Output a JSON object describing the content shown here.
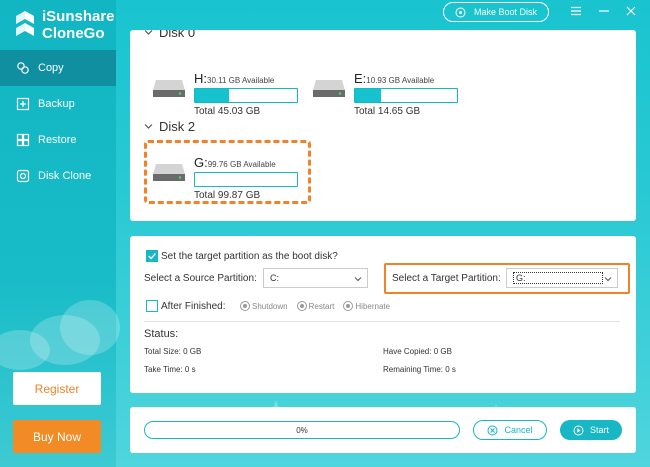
{
  "app": {
    "title_line1": "iSunshare",
    "title_line2": "CloneGo"
  },
  "sidebar": {
    "items": [
      {
        "label": "Copy",
        "icon": "copy-icon",
        "active": true
      },
      {
        "label": "Backup",
        "icon": "backup-icon"
      },
      {
        "label": "Restore",
        "icon": "restore-icon"
      },
      {
        "label": "Disk Clone",
        "icon": "disk-clone-icon"
      }
    ],
    "register_label": "Register",
    "buy_label": "Buy Now"
  },
  "topbar": {
    "boot_label": "Make Boot Disk"
  },
  "disks": {
    "disk0": {
      "heading": "Disk 0",
      "partitions": [
        {
          "letter": "H:",
          "available": "30.11 GB Available",
          "total": "Total 45.03 GB",
          "used_fraction": 0.33
        },
        {
          "letter": "E:",
          "available": "10.93 GB Available",
          "total": "Total 14.65 GB",
          "used_fraction": 0.25
        }
      ]
    },
    "disk2": {
      "heading": "Disk 2",
      "partitions": [
        {
          "letter": "G:",
          "available": "99.76 GB Available",
          "total": "Total 99.87 GB",
          "used_fraction": 0.0
        }
      ]
    }
  },
  "settings": {
    "boot_check_label": "Set the target partition as the boot disk?",
    "boot_checked": true,
    "source_label": "Select a Source Partition:",
    "source_value": "C:",
    "target_label": "Select a Target Partition:",
    "target_value": "G:",
    "after_label": "After Finished:",
    "after_checked": false,
    "options": [
      "Shutdown",
      "Restart",
      "Hibernate"
    ],
    "status_heading": "Status:",
    "total_size": "Total Size: 0 GB",
    "have_copied": "Have Copied: 0 GB",
    "take_time": "Take Time: 0 s",
    "remaining_time": "Remaining Time: 0 s"
  },
  "progress": {
    "percent_label": "0%",
    "value": 0,
    "cancel_label": "Cancel",
    "start_label": "Start"
  },
  "colors": {
    "accent": "#17b7c5",
    "highlight": "#f0832a",
    "sidebar_active": "#0f8fa0"
  }
}
